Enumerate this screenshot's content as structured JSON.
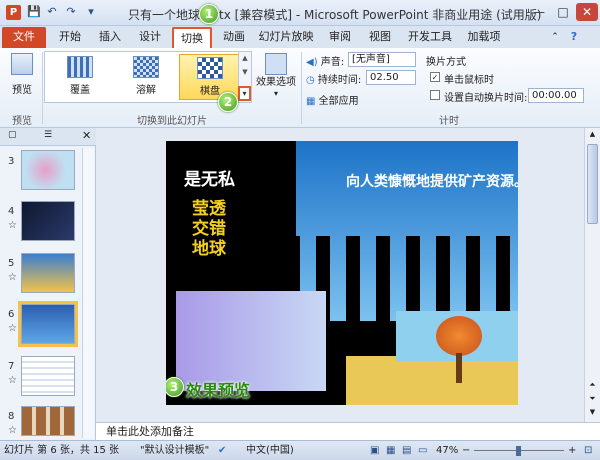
{
  "window": {
    "title": "只有一个地球.pptx [兼容模式] - Microsoft PowerPoint 非商业用途 (试用版)",
    "app_icon_letter": "P",
    "minimize": "—",
    "maximize": "□",
    "close": "✕"
  },
  "quick_access": {
    "save": "💾",
    "undo": "↶",
    "redo": "↷",
    "customize": "▾"
  },
  "tabs": [
    "文件",
    "开始",
    "插入",
    "设计",
    "切换",
    "动画",
    "幻灯片放映",
    "审阅",
    "视图",
    "开发工具",
    "加载项"
  ],
  "active_tab": "切换",
  "ribbon": {
    "preview_label": "预览",
    "preview_group": "预览",
    "gallery": [
      {
        "label": "覆盖"
      },
      {
        "label": "溶解"
      },
      {
        "label": "棋盘"
      }
    ],
    "selected_transition": "棋盘",
    "effect_options_label": "效果选项",
    "group_label": "切换到此幻灯片",
    "sound_label": "声音:",
    "sound_value": "[无声音]",
    "duration_label": "持续时间:",
    "duration_value": "02.50",
    "apply_all_label": "全部应用",
    "advance_title": "换片方式",
    "on_click_label": "单击鼠标时",
    "on_click_checked": true,
    "auto_after_label": "设置自动换片时间:",
    "auto_after_checked": false,
    "auto_after_value": "00:00.00",
    "timing_group": "计时"
  },
  "badges": {
    "b1": "1",
    "b2": "2",
    "b3": "3"
  },
  "slides": {
    "numbers": [
      "3",
      "4",
      "5",
      "6",
      "7",
      "8"
    ],
    "selected": "6",
    "star": "☆"
  },
  "slide": {
    "text_line1": "是无私",
    "text_right": "向人类慷慨地提供矿产资源。",
    "text_block": [
      "莹透",
      "交错",
      "地球"
    ],
    "preview_caption": "效果预览"
  },
  "notes_placeholder": "单击此处添加备注",
  "status": {
    "slide_info": "幻灯片 第 6 张，共 15 张",
    "theme": "\"默认设计模板\"",
    "language": "中文(中国)",
    "zoom": "47%"
  },
  "colors": {
    "accent_file": "#d24726",
    "selected_gallery": "#ffd85a",
    "badge_green": "#3f9a1c",
    "highlight_border": "#e2572c"
  }
}
